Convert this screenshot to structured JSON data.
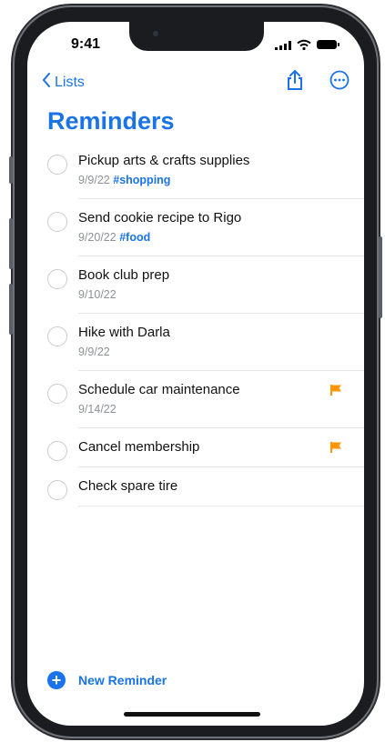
{
  "status": {
    "time": "9:41"
  },
  "nav": {
    "back_label": "Lists"
  },
  "page_title": "Reminders",
  "reminders": [
    {
      "title": "Pickup arts & crafts supplies",
      "date": "9/9/22",
      "tag": "#shopping",
      "flagged": false
    },
    {
      "title": "Send cookie recipe to Rigo",
      "date": "9/20/22",
      "tag": "#food",
      "flagged": false
    },
    {
      "title": "Book club prep",
      "date": "9/10/22",
      "tag": "",
      "flagged": false
    },
    {
      "title": "Hike with Darla",
      "date": "9/9/22",
      "tag": "",
      "flagged": false
    },
    {
      "title": "Schedule car maintenance",
      "date": "9/14/22",
      "tag": "",
      "flagged": true
    },
    {
      "title": "Cancel membership",
      "date": "",
      "tag": "",
      "flagged": true
    },
    {
      "title": "Check spare tire",
      "date": "",
      "tag": "",
      "flagged": false
    }
  ],
  "footer": {
    "new_reminder_label": "New Reminder"
  },
  "colors": {
    "accent": "#1a73e8",
    "flag": "#ff9500"
  }
}
